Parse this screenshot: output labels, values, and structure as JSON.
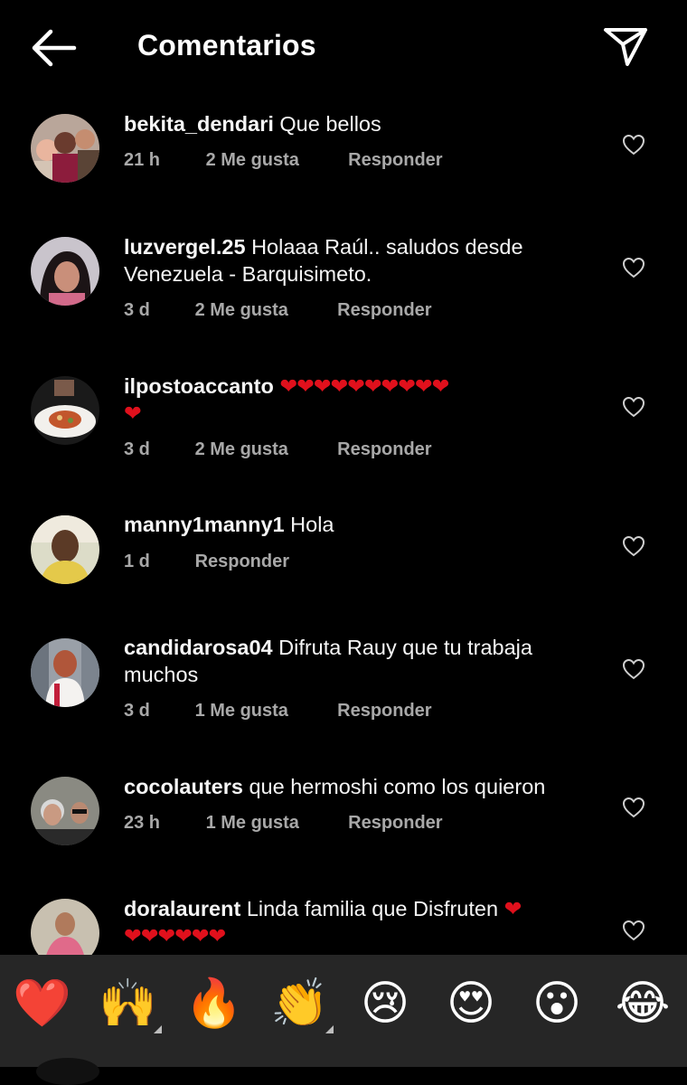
{
  "header": {
    "title": "Comentarios"
  },
  "comments": [
    {
      "username": "bekita_dendari",
      "text": "Que bellos",
      "text2": "",
      "hearts": "",
      "hearts2": "",
      "time": "21 h",
      "likes": "2 Me gusta",
      "reply": "Responder"
    },
    {
      "username": "luzvergel.25",
      "text": "Holaaa Raúl.. saludos desde",
      "text2": "Venezuela - Barquisimeto.",
      "hearts": "",
      "hearts2": "",
      "time": "3 d",
      "likes": "2 Me gusta",
      "reply": "Responder"
    },
    {
      "username": "ilpostoaccanto",
      "text": "",
      "text2": "",
      "hearts": "❤❤❤❤❤❤❤❤❤❤",
      "hearts2": "❤",
      "time": "3 d",
      "likes": "2 Me gusta",
      "reply": "Responder"
    },
    {
      "username": "manny1manny1",
      "text": "Hola",
      "text2": "",
      "hearts": "",
      "hearts2": "",
      "time": "1 d",
      "likes": "",
      "reply": "Responder"
    },
    {
      "username": "candidarosa04",
      "text": "Difruta Rauy que tu trabaja",
      "text2": "muchos",
      "hearts": "",
      "hearts2": "",
      "time": "3 d",
      "likes": "1 Me gusta",
      "reply": "Responder"
    },
    {
      "username": "cocolauters",
      "text": "que hermoshi como los quieron",
      "text2": "",
      "hearts": "",
      "hearts2": "",
      "time": "23 h",
      "likes": "1 Me gusta",
      "reply": "Responder"
    },
    {
      "username": "doralaurent",
      "text": "Linda  familia  que  Disfruten",
      "text2": "",
      "hearts": "❤",
      "hearts2": "❤❤❤❤❤❤",
      "time": "",
      "likes": "",
      "reply": ""
    }
  ],
  "reactions": [
    "❤️",
    "🙌",
    "🔥",
    "👏",
    "😢",
    "😍",
    "😮",
    "😂"
  ],
  "colors": {
    "background": "#000000",
    "meta_text": "#a8a8a8",
    "heart_red": "#e0101c",
    "emoji_bar": "#262626"
  }
}
